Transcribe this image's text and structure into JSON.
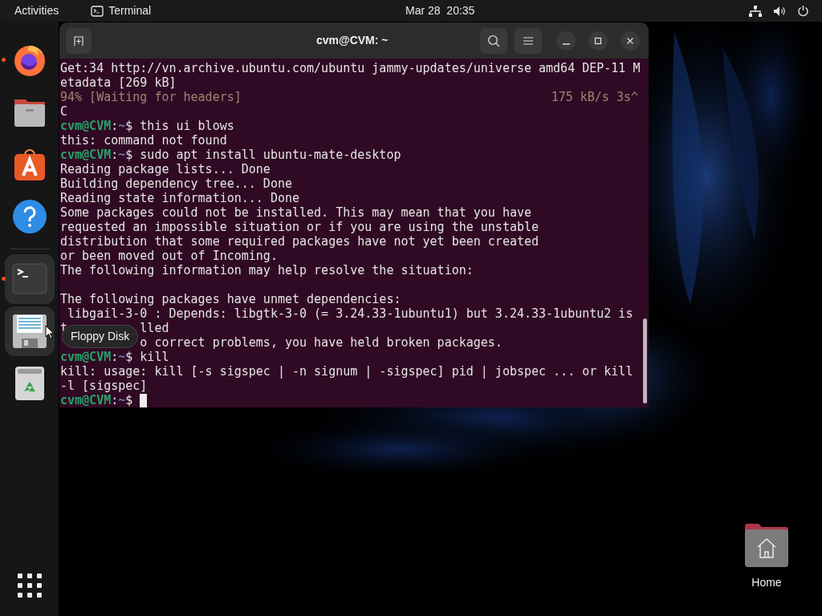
{
  "top_bar": {
    "activities": "Activities",
    "app_name": "Terminal",
    "clock": "Mar 28  20:35"
  },
  "dock": {
    "items": [
      {
        "kind": "firefox",
        "running": true,
        "highlighted": false
      },
      {
        "kind": "files",
        "running": false,
        "highlighted": false
      },
      {
        "kind": "store",
        "running": false,
        "highlighted": false
      },
      {
        "kind": "help",
        "running": false,
        "highlighted": false
      },
      {
        "kind": "separator"
      },
      {
        "kind": "terminal",
        "running": true,
        "highlighted": true
      },
      {
        "kind": "floppy",
        "running": false,
        "highlighted": true
      },
      {
        "kind": "trash",
        "running": false,
        "highlighted": false
      }
    ],
    "tooltip": "Floppy Disk"
  },
  "terminal": {
    "title": "cvm@CVM: ~",
    "lines": [
      {
        "kind": "output",
        "text": "Get:34 http://vn.archive.ubuntu.com/ubuntu jammy-updates/universe amd64 DEP-11 M"
      },
      {
        "kind": "output",
        "text": "etadata [269 kB]"
      },
      {
        "kind": "progress",
        "text": "94% [Waiting for headers]",
        "right": "175 kB/s 3s^"
      },
      {
        "kind": "output",
        "text": "C"
      },
      {
        "kind": "prompt",
        "user": "cvm@CVM",
        "colon": ":",
        "path": "~",
        "dollar": "$",
        "command": "this ui blows",
        "cursor": false
      },
      {
        "kind": "output",
        "text": "this: command not found"
      },
      {
        "kind": "prompt",
        "user": "cvm@CVM",
        "colon": ":",
        "path": "~",
        "dollar": "$",
        "command": "sudo apt install ubuntu-mate-desktop",
        "cursor": false
      },
      {
        "kind": "output",
        "text": "Reading package lists... Done"
      },
      {
        "kind": "output",
        "text": "Building dependency tree... Done"
      },
      {
        "kind": "output",
        "text": "Reading state information... Done"
      },
      {
        "kind": "output",
        "text": "Some packages could not be installed. This may mean that you have"
      },
      {
        "kind": "output",
        "text": "requested an impossible situation or if you are using the unstable"
      },
      {
        "kind": "output",
        "text": "distribution that some required packages have not yet been created"
      },
      {
        "kind": "output",
        "text": "or been moved out of Incoming."
      },
      {
        "kind": "output",
        "text": "The following information may help resolve the situation:"
      },
      {
        "kind": "blank"
      },
      {
        "kind": "output",
        "text": "The following packages have unmet dependencies:"
      },
      {
        "kind": "output",
        "text": " libgail-3-0 : Depends: libgtk-3-0 (= 3.24.33-1ubuntu1) but 3.24.33-1ubuntu2 is"
      },
      {
        "kind": "output",
        "text": "t          lled"
      },
      {
        "kind": "output",
        "text": "           o correct problems, you have held broken packages."
      },
      {
        "kind": "prompt",
        "user": "cvm@CVM",
        "colon": ":",
        "path": "~",
        "dollar": "$",
        "command": "kill",
        "cursor": false
      },
      {
        "kind": "output",
        "text": "kill: usage: kill [-s sigspec | -n signum | -sigspec] pid | jobspec ... or kill"
      },
      {
        "kind": "output",
        "text": "-l [sigspec]"
      },
      {
        "kind": "prompt",
        "user": "cvm@CVM",
        "colon": ":",
        "path": "~",
        "dollar": "$",
        "cursor": true
      }
    ]
  },
  "desktop_icons": [
    {
      "label": "Home"
    }
  ]
}
